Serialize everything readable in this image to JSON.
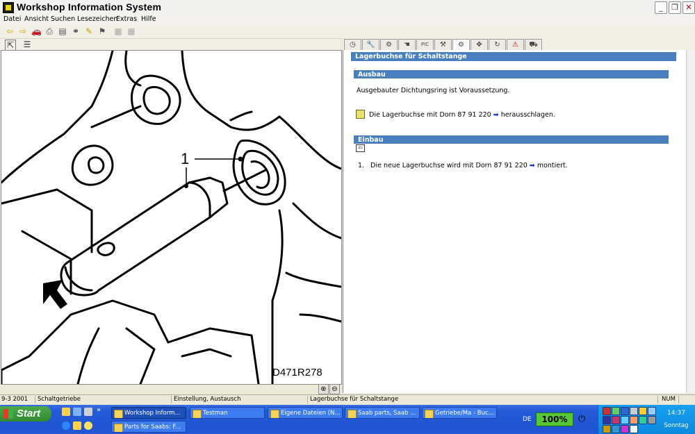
{
  "window": {
    "title": "Workshop Information System"
  },
  "menu": [
    "Datei",
    "Ansicht",
    "Suchen",
    "Lesezeichen",
    "Extras",
    "Hilfe"
  ],
  "right": {
    "page_title": "Lagerbuchse für Schaltstange",
    "sections": {
      "ausbau": {
        "heading": "Ausbau",
        "note": "Ausgebauter Dichtungsring ist Voraussetzung.",
        "step_text": "Die Lagerbuchse mit Dorn 87 91 220",
        "step_suffix": "herausschlagen."
      },
      "einbau": {
        "heading": "Einbau",
        "step_number": "1.",
        "step_text": "Die neue Lagerbuchse wird mit Dorn 87 91 220",
        "step_suffix": "montiert."
      }
    }
  },
  "illustration": {
    "callout": "1",
    "code": "D471R278"
  },
  "status": [
    "9-3 2001",
    "Schaltgetriebe",
    "Einstellung, Austausch",
    "Lagerbuchse für Schaltstange",
    "NUM"
  ],
  "taskbar": {
    "start": "Start",
    "tasks_top": [
      "Workshop Inform...",
      "Testman",
      "Eigene Dateien (N...",
      "Saab parts, Saab ...",
      "Getriebe/Ma - Buc..."
    ],
    "tasks_bottom": [
      "Parts for Saabs: F..."
    ],
    "lang": "DE",
    "battery": "100%",
    "clock": "14:37",
    "day": "Sonntag"
  },
  "colors": {
    "section_bar": "#4a7fbf",
    "taskbar": "#245bd8",
    "tray": "#0b88e0",
    "start": "#3a9a38"
  }
}
